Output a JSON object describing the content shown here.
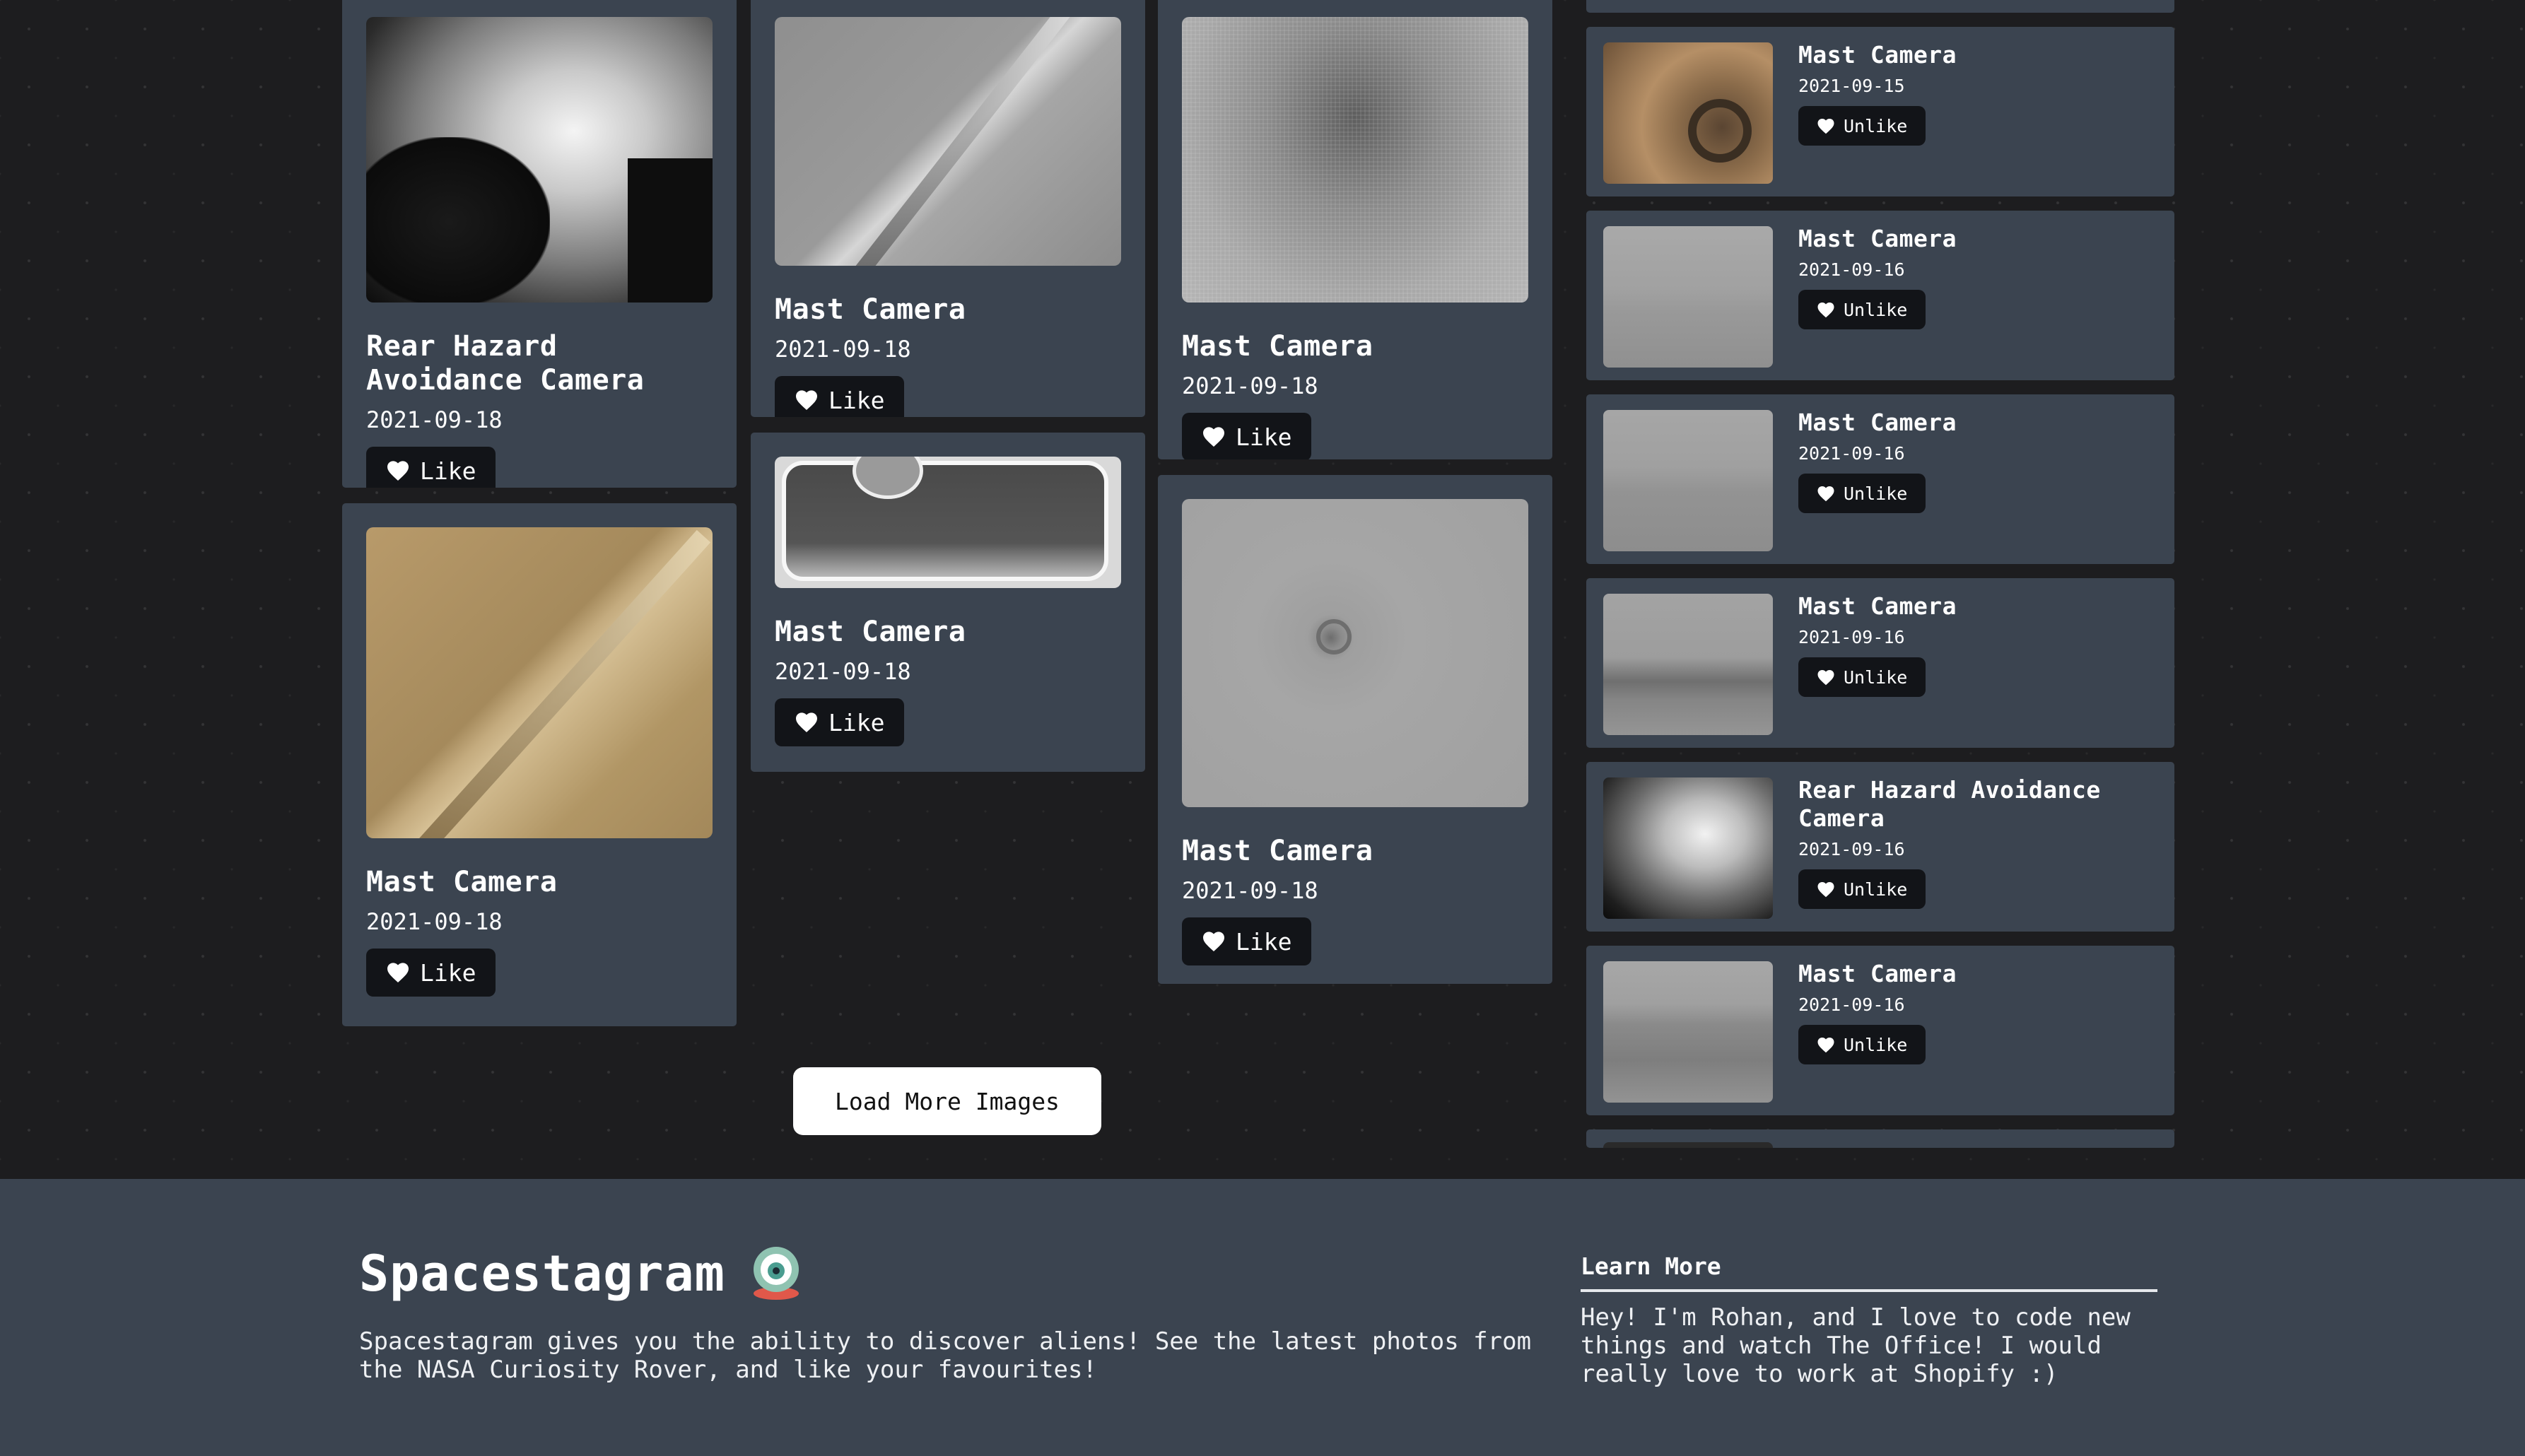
{
  "colors": {
    "background": "#1d1d1f",
    "card": "#3b4450",
    "button": "#121418",
    "footer": "#3b4450"
  },
  "gallery": {
    "cards": [
      {
        "id": "c1",
        "title": "Rear Hazard Avoidance Camera",
        "date": "2021-09-18",
        "like_label": "Like",
        "icon": "heart-icon",
        "image": "hazcam-fisheye-shadow"
      },
      {
        "id": "c2",
        "title": "Mast Camera",
        "date": "2021-09-18",
        "like_label": "Like",
        "icon": "heart-icon",
        "image": "tan-rock-crack"
      },
      {
        "id": "c3",
        "title": "Mast Camera",
        "date": "2021-09-18",
        "like_label": "Like",
        "icon": "heart-icon",
        "image": "gray-rock-crack"
      },
      {
        "id": "c4",
        "title": "Mast Camera",
        "date": "2021-09-18",
        "like_label": "Like",
        "icon": "heart-icon",
        "image": "sample-tray"
      },
      {
        "id": "c5",
        "title": "Mast Camera",
        "date": "2021-09-18",
        "like_label": "Like",
        "icon": "heart-icon",
        "image": "grainy-closeup"
      },
      {
        "id": "c6",
        "title": "Mast Camera",
        "date": "2021-09-18",
        "like_label": "Like",
        "icon": "heart-icon",
        "image": "drill-hole"
      }
    ],
    "load_more_label": "Load More Images"
  },
  "favourites": [
    {
      "title": "Mast Camera",
      "date": "2021-09-15",
      "unlike_label": "Unlike",
      "image": "rover-hardware"
    },
    {
      "title": "Mast Camera",
      "date": "2021-09-16",
      "unlike_label": "Unlike",
      "image": "hazy-landscape"
    },
    {
      "title": "Mast Camera",
      "date": "2021-09-16",
      "unlike_label": "Unlike",
      "image": "hazy-landscape"
    },
    {
      "title": "Mast Camera",
      "date": "2021-09-16",
      "unlike_label": "Unlike",
      "image": "hazy-landscape"
    },
    {
      "title": "Rear Hazard Avoidance Camera",
      "date": "2021-09-16",
      "unlike_label": "Unlike",
      "image": "hazcam-fisheye"
    },
    {
      "title": "Mast Camera",
      "date": "2021-09-16",
      "unlike_label": "Unlike",
      "image": "rocky-terrain"
    }
  ],
  "footer": {
    "brand": "Spacestagram",
    "logo_icon": "alien-eye-icon",
    "description": "Spacestagram gives you the ability to discover aliens! See the latest photos from the NASA Curiosity Rover, and like your favourites!",
    "learn_more_heading": "Learn More",
    "learn_more_text": "Hey! I'm Rohan, and I love to code new things and watch The Office! I would really love to work at Shopify :)"
  }
}
